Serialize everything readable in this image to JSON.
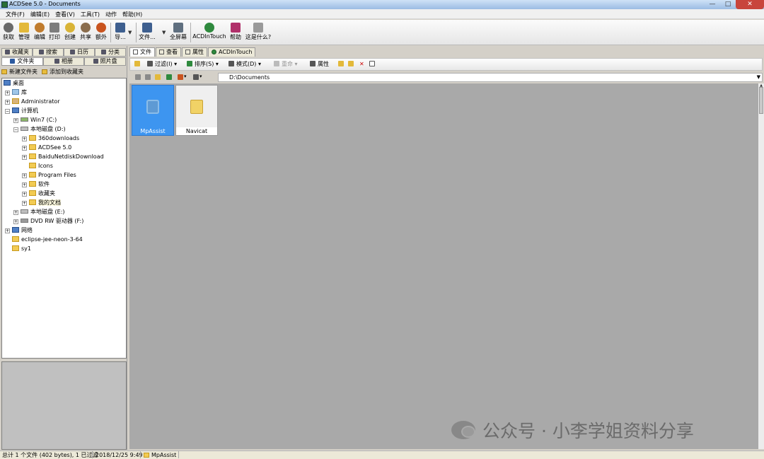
{
  "window": {
    "title": "ACDSee 5.0 - Documents",
    "min": "—",
    "max": "□",
    "close": "✕"
  },
  "menu": [
    "文件(F)",
    "编辑(E)",
    "查看(V)",
    "工具(T)",
    "动作",
    "帮助(H)"
  ],
  "toolbar": {
    "acquire": "获取",
    "manage": "管理",
    "edit": "编辑",
    "print": "打印",
    "create": "创建",
    "share": "共享",
    "extra": "额外",
    "nav": "导...",
    "file": "文件...",
    "fullscreen": "全屏幕",
    "acdintouch": "ACDInTouch",
    "help": "帮助",
    "whatsthis": "这是什么?"
  },
  "left": {
    "tabs_row1": [
      "收藏夹",
      "搜索",
      "日历",
      "分类"
    ],
    "tabs_row2": [
      "文件夹",
      "相册",
      "照片盘"
    ],
    "actions": {
      "new_folder": "新建文件夹",
      "add_favorite": "添加到收藏夹"
    },
    "tree": [
      {
        "label": "桌面"
      },
      {
        "label": "库"
      },
      {
        "label": "Administrator"
      },
      {
        "label": "计算机"
      },
      {
        "label": "Win7 (C:)"
      },
      {
        "label": "本地磁盘 (D:)"
      },
      {
        "label": "360downloads"
      },
      {
        "label": "ACDSee 5.0"
      },
      {
        "label": "BaiduNetdiskDownload"
      },
      {
        "label": "Icons"
      },
      {
        "label": "Program Files"
      },
      {
        "label": "软件"
      },
      {
        "label": "收藏夹"
      },
      {
        "label": "我的文档"
      },
      {
        "label": "本地磁盘 (E:)"
      },
      {
        "label": "DVD RW 驱动器 (F:)"
      },
      {
        "label": "网络"
      },
      {
        "label": "eclipse-jee-neon-3-64"
      },
      {
        "label": "sy1"
      }
    ]
  },
  "right": {
    "tabs": [
      "文件",
      "查看",
      "属性",
      "ACDInTouch"
    ],
    "ctoolbar": {
      "filter": "过滤(I)",
      "sort": "排序(S)",
      "mode": "模式(D)",
      "rename": "重命",
      "props": "属性"
    },
    "path": "D:\\Documents",
    "files": [
      {
        "name": "MpAssist",
        "selected": true
      },
      {
        "name": "Navicat",
        "selected": false
      }
    ]
  },
  "status": {
    "summary": "总计 1 个文件 (402 bytes), 1 已过滤",
    "datetime": "2018/12/25 9:49",
    "file": "MpAssist"
  },
  "watermark": "公众号 · 小李学姐资料分享"
}
